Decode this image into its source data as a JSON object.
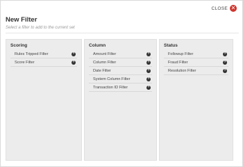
{
  "dialog": {
    "close_label": "CLOSE",
    "close_icon": "close-circle-icon",
    "title": "New Filter",
    "subtitle": "Select a filter to add to the current set"
  },
  "panels": [
    {
      "title": "Scoring",
      "items": [
        {
          "label": "Rules Tripped Filter",
          "icon": "help-icon"
        },
        {
          "label": "Score Filter",
          "icon": "help-icon"
        }
      ]
    },
    {
      "title": "Column",
      "items": [
        {
          "label": "Amount Filter",
          "icon": "help-icon"
        },
        {
          "label": "Column Filter",
          "icon": "help-icon"
        },
        {
          "label": "Date Filter",
          "icon": "help-icon"
        },
        {
          "label": "System Column Filter",
          "icon": "help-icon"
        },
        {
          "label": "Transaction ID Filter",
          "icon": "help-icon"
        }
      ]
    },
    {
      "title": "Status",
      "items": [
        {
          "label": "Followup Filter",
          "icon": "help-icon"
        },
        {
          "label": "Fraud Filter",
          "icon": "help-icon"
        },
        {
          "label": "Resolution Filter",
          "icon": "help-icon"
        }
      ]
    }
  ],
  "colors": {
    "close_icon_bg": "#d0342c",
    "panel_bg": "#ececec",
    "help_icon_bg": "#333333"
  }
}
